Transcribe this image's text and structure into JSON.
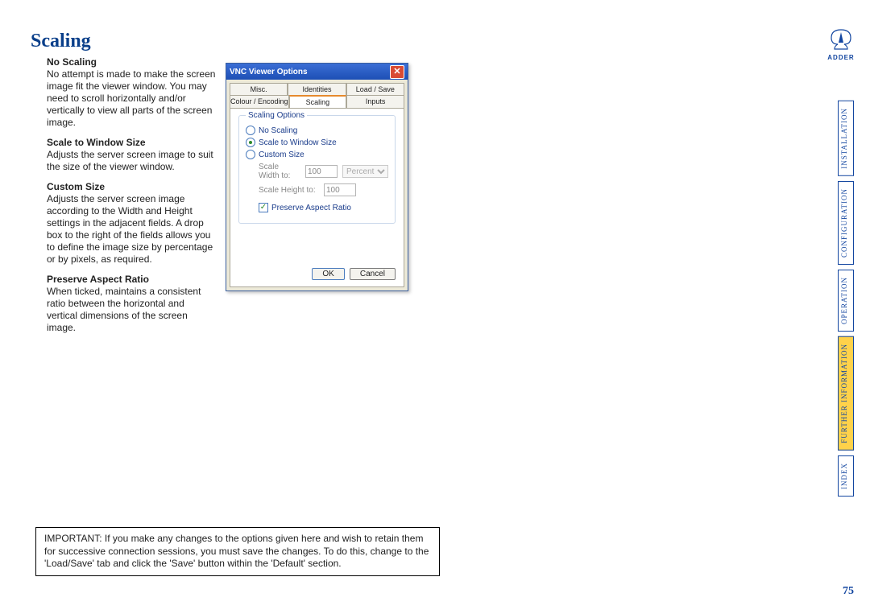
{
  "brand": "ADDER",
  "heading": "Scaling",
  "sections": [
    {
      "title": "No Scaling",
      "body": "No attempt is made to make the screen image fit the viewer window. You may need to scroll horizontally and/or vertically to view all parts of the screen image."
    },
    {
      "title": "Scale to Window Size",
      "body": "Adjusts the server screen image to suit the size of the viewer window."
    },
    {
      "title": "Custom Size",
      "body": "Adjusts the server screen image according to the Width and Height settings in the adjacent fields. A drop box to the right of the fields allows you to define the image size by percentage or by pixels, as required."
    },
    {
      "title": "Preserve Aspect Ratio",
      "body": "When ticked, maintains a consistent ratio between the horizontal and vertical dimensions of the screen image."
    }
  ],
  "dialog": {
    "title": "VNC Viewer Options",
    "tabs_row1": [
      "Misc.",
      "Identities",
      "Load / Save"
    ],
    "tabs_row2": [
      "Colour / Encoding",
      "Scaling",
      "Inputs"
    ],
    "active_tab": "Scaling",
    "group_title": "Scaling Options",
    "radios": [
      {
        "label": "No Scaling",
        "checked": false
      },
      {
        "label": "Scale to Window Size",
        "checked": true
      },
      {
        "label": "Custom Size",
        "checked": false
      }
    ],
    "width_label": "Scale Width to:",
    "width_value": "100",
    "height_label": "Scale Height to:",
    "height_value": "100",
    "unit": "Percent",
    "preserve_label": "Preserve Aspect Ratio",
    "preserve_checked": true,
    "ok": "OK",
    "cancel": "Cancel"
  },
  "important": "IMPORTANT: If you make any changes to the options given here and wish to retain them for successive connection sessions, you must save the changes. To do this, change to the 'Load/Save' tab and click the 'Save' button within the 'Default' section.",
  "sidenav": [
    {
      "label": "INSTALLATION",
      "active": false
    },
    {
      "label": "CONFIGURATION",
      "active": false
    },
    {
      "label": "OPERATION",
      "active": false
    },
    {
      "label": "FURTHER INFORMATION",
      "active": true
    },
    {
      "label": "INDEX",
      "active": false
    }
  ],
  "page_number": "75"
}
